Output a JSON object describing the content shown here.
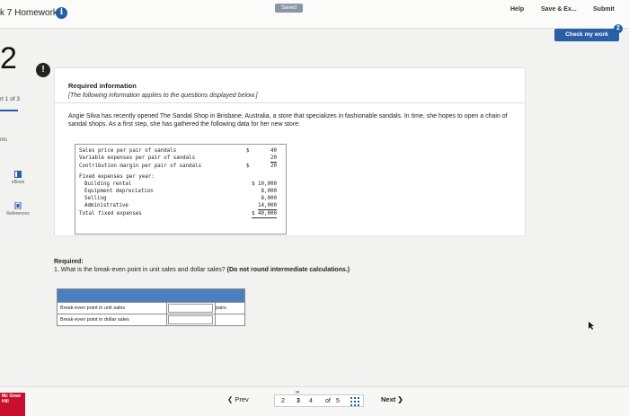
{
  "topbar": {
    "title": "k 7 Homework",
    "info_glyph": "i",
    "saved": "Saved",
    "help": "Help",
    "save_exit": "Save & Ex...",
    "submit": "Submit",
    "check_work": "Check my work",
    "check_badge": "2"
  },
  "sidebar": {
    "question_number": "2",
    "part": "rt 1 of 3",
    "points": "nts",
    "ebook": "eBook",
    "references": "References"
  },
  "panel": {
    "alert_glyph": "!",
    "heading": "Required information",
    "note": "[The following information applies to the questions displayed below.]",
    "paragraph": "Angie Silva has recently opened The Sandal Shop in Brisbane, Australia, a store that specializes in fashionable sandals. In time, she hopes to open a chain of sandal shops. As a first step, she has gathered the following data for her new store:"
  },
  "data_table": {
    "sales_price_label": "Sales price per pair of sandals",
    "sales_price_dollar": "$",
    "sales_price": "40",
    "variable_label": "Variable expenses per pair of sandals",
    "variable": "20",
    "cm_label": "Contribution margin per pair of sandals",
    "cm_dollar": "$",
    "cm": "20",
    "fixed_label": "Fixed expenses per year:",
    "rental_label": "Building rental",
    "rental": "$ 10,000",
    "depreciation_label": "Equipment depreciation",
    "depreciation": "8,000",
    "selling_label": "Selling",
    "selling": "8,000",
    "admin_label": "Administrative",
    "admin": "14,000",
    "total_label": "Total fixed expenses",
    "total": "$ 40,000"
  },
  "required": {
    "heading": "Required:",
    "question": "1. What is the break-even point in unit sales and dollar sales?",
    "instruction": "(Do not round intermediate calculations.)"
  },
  "answer_table": {
    "row1_label": "Break-even point in unit sales",
    "row1_unit": "pairs",
    "row2_label": "Break-even point in dollar sales"
  },
  "bottombar": {
    "logo_text": "Mc Graw Hill",
    "prev": "Prev",
    "page_2": "2",
    "page_3": "3",
    "page_4": "4",
    "of": "of",
    "total_pages": "5",
    "next": "Next"
  }
}
